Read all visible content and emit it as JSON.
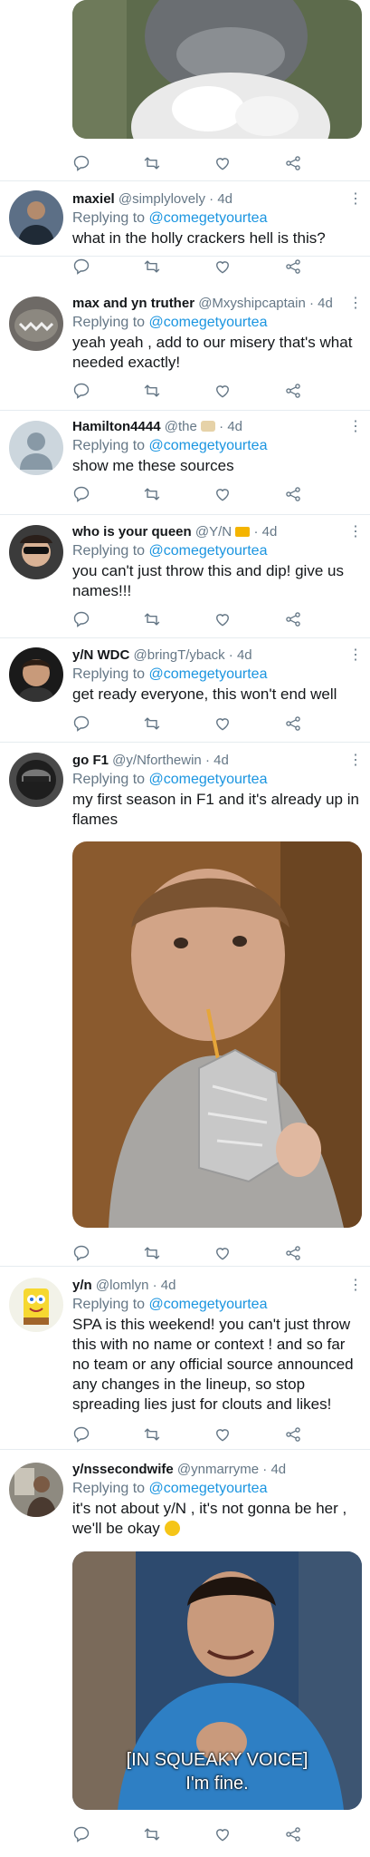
{
  "reply_prefix": "Replying to",
  "reply_handle": "@comegetyourtea",
  "icons": [
    "reply-icon",
    "retweet-icon",
    "like-icon",
    "share-icon",
    "more-icon"
  ],
  "colors": {
    "text": "#14171a",
    "muted": "#657786",
    "link": "#1b95e0",
    "divider": "#e6ecf0"
  },
  "tweets": [
    {
      "name": "maxiel",
      "handle": "@simplylovely",
      "time": "4d",
      "text": "what in the holly crackers hell is this?"
    },
    {
      "name": "max and yn truther",
      "handle": "@Mxyshipcaptain",
      "time": "4d",
      "text": "yeah yeah , add to our misery that's what needed exactly!"
    },
    {
      "name": "Hamilton4444",
      "handle": "@the",
      "time": "4d",
      "text": "show me these sources"
    },
    {
      "name": "who is your queen",
      "handle": "@Y/N",
      "time": "4d",
      "text": "you can't just throw this and dip! give us names!!!"
    },
    {
      "name": "y/N WDC",
      "handle": "@bringT/yback",
      "time": "4d",
      "text": "get ready everyone, this won't end well"
    },
    {
      "name": "go F1",
      "handle": "@y/Nforthewin",
      "time": "4d",
      "text": "my first season in F1 and it's already up in flames"
    },
    {
      "name": "y/n",
      "handle": "@lomlyn",
      "time": "4d",
      "text": "SPA is this weekend! you can't just throw this with no name or context ! and so far no team or any official source announced any changes in the lineup, so stop spreading lies just for clouts and likes!"
    },
    {
      "name": "y/nssecondwife",
      "handle": "@ynmarryme",
      "time": "4d",
      "text": "it's not about y/N , it's not gonna be her , we'll be okay",
      "media_caption_1": "[IN SQUEAKY VOICE]",
      "media_caption_2": "I'm fine."
    }
  ]
}
